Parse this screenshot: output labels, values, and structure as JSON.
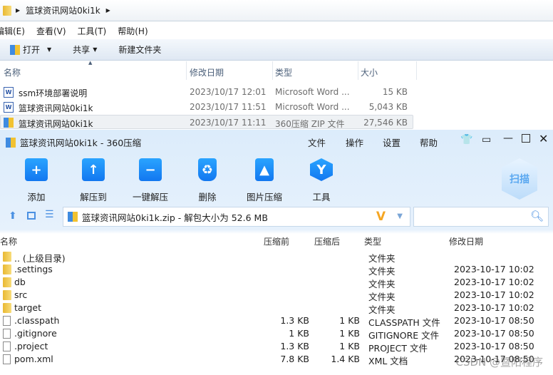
{
  "explorer": {
    "breadcrumb": "篮球资讯网站0ki1k",
    "menu": [
      "编辑(E)",
      "查看(V)",
      "工具(T)",
      "帮助(H)"
    ],
    "toolbar": {
      "open": "打开",
      "share": "共享",
      "new_folder": "新建文件夹"
    },
    "columns": [
      "名称",
      "修改日期",
      "类型",
      "大小"
    ],
    "rows": [
      {
        "name": "ssm环境部署说明",
        "date": "2023/10/17 12:01",
        "type": "Microsoft Word ...",
        "size": "15 KB",
        "icon": "word-icon"
      },
      {
        "name": "篮球资讯网站0ki1k",
        "date": "2023/10/17 11:51",
        "type": "Microsoft Word ...",
        "size": "5,043 KB",
        "icon": "word-icon"
      },
      {
        "name": "篮球资讯网站0ki1k",
        "date": "2023/10/17 11:11",
        "type": "360压缩 ZIP 文件",
        "size": "27,546 KB",
        "icon": "zip-icon"
      }
    ]
  },
  "zip": {
    "title": "篮球资讯网站0ki1k - 360压缩",
    "menu": [
      "文件",
      "操作",
      "设置",
      "帮助"
    ],
    "tools": [
      "添加",
      "解压到",
      "一键解压",
      "删除",
      "图片压缩",
      "工具"
    ],
    "scan": "扫描",
    "address": "篮球资讯网站0ki1k.zip - 解包大小为 52.6 MB",
    "columns": [
      "名称",
      "压缩前",
      "压缩后",
      "类型",
      "修改日期"
    ],
    "rows": [
      {
        "name": ".. (上级目录)",
        "before": "",
        "after": "",
        "type": "文件夹",
        "date": "",
        "icon": "folder"
      },
      {
        "name": ".settings",
        "before": "",
        "after": "",
        "type": "文件夹",
        "date": "2023-10-17 10:02",
        "icon": "folder"
      },
      {
        "name": "db",
        "before": "",
        "after": "",
        "type": "文件夹",
        "date": "2023-10-17 10:02",
        "icon": "folder"
      },
      {
        "name": "src",
        "before": "",
        "after": "",
        "type": "文件夹",
        "date": "2023-10-17 10:02",
        "icon": "folder"
      },
      {
        "name": "target",
        "before": "",
        "after": "",
        "type": "文件夹",
        "date": "2023-10-17 10:02",
        "icon": "folder"
      },
      {
        "name": ".classpath",
        "before": "1.3 KB",
        "after": "1 KB",
        "type": "CLASSPATH 文件",
        "date": "2023-10-17 08:50",
        "icon": "file"
      },
      {
        "name": ".gitignore",
        "before": "1 KB",
        "after": "1 KB",
        "type": "GITIGNORE 文件",
        "date": "2023-10-17 08:50",
        "icon": "file"
      },
      {
        "name": ".project",
        "before": "1.3 KB",
        "after": "1 KB",
        "type": "PROJECT 文件",
        "date": "2023-10-17 08:50",
        "icon": "file"
      },
      {
        "name": "pom.xml",
        "before": "7.8 KB",
        "after": "1.4 KB",
        "type": "XML 文档",
        "date": "2023-10-17 08:50",
        "icon": "xml"
      }
    ]
  },
  "watermark": "CSDN @暨阳程序"
}
